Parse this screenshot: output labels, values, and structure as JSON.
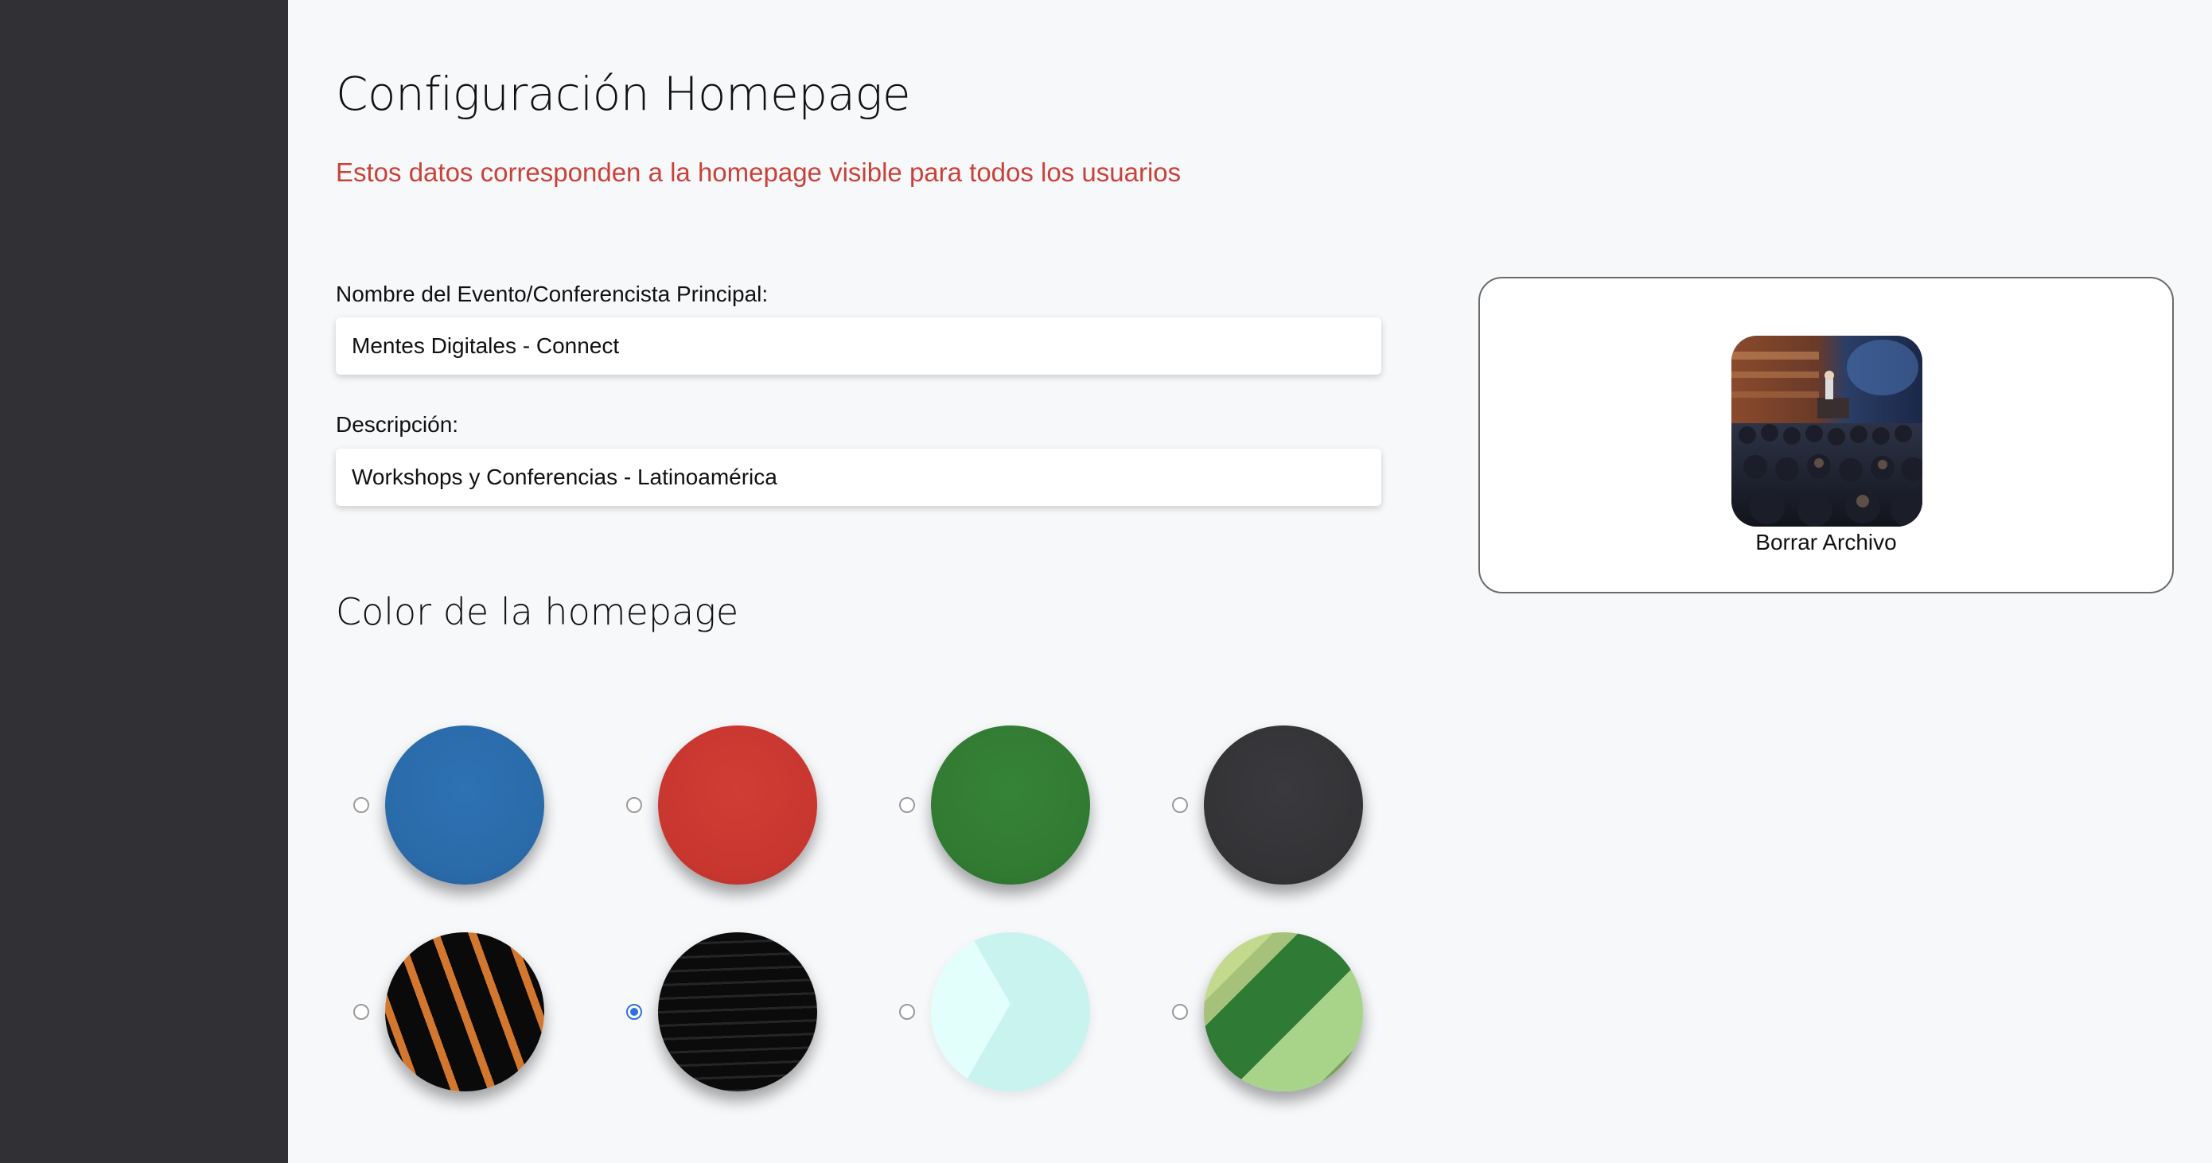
{
  "header": {
    "title": "Configuración Homepage",
    "subtitle": "Estos datos corresponden a la homepage visible para todos los usuarios"
  },
  "form": {
    "event_name_label": "Nombre del Evento/Conferencista Principal:",
    "event_name_value": "Mentes Digitales - Connect",
    "description_label": "Descripción:",
    "description_value": "Workshops y Conferencias - Latinoamérica"
  },
  "colors_section": {
    "title": "Color de la homepage",
    "selected_index": 5,
    "swatches": [
      {
        "name": "blue",
        "color": "#2a6aa8"
      },
      {
        "name": "red",
        "color": "#c7362f"
      },
      {
        "name": "green",
        "color": "#317a32"
      },
      {
        "name": "dark",
        "color": "#333336"
      },
      {
        "name": "black-orange-stripes",
        "color": "#0a0a0a",
        "accent": "#d4772e"
      },
      {
        "name": "black-wave",
        "color": "#0b0b0b",
        "accent": "#222222"
      },
      {
        "name": "mint-triangle",
        "color": "#cff6f3",
        "accent": "#e4fffd"
      },
      {
        "name": "green-diagonal",
        "color": "#a9cd7d",
        "accent": "#2f7a34"
      }
    ]
  },
  "media": {
    "delete_label": "Borrar Archivo",
    "thumbnail_icon": "conference-photo"
  }
}
